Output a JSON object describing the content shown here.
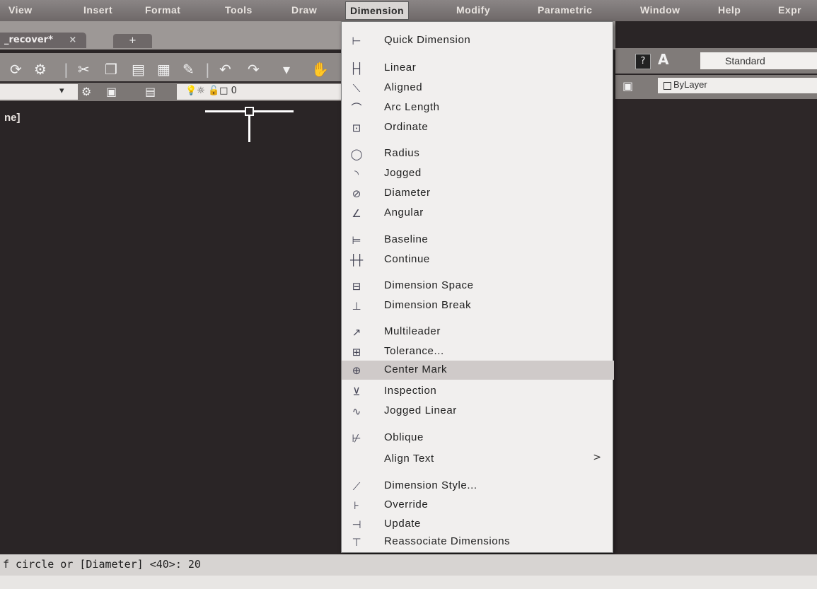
{
  "menubar": {
    "items": [
      "View",
      "Insert",
      "Format",
      "Tools",
      "Draw",
      "Dimension",
      "Modify",
      "Parametric",
      "Window",
      "Help",
      "Expr"
    ],
    "active": "Dimension"
  },
  "file_tabs": {
    "current": "_recover*",
    "close_symbol": "×",
    "new_tab_symbol": "+"
  },
  "toolbar_right": {
    "help_symbol": "?",
    "text_style_icon": "A",
    "text_style_value": "Standard",
    "layer_value": "ByLayer"
  },
  "layer_control": {
    "layer_name": "0"
  },
  "viewport": {
    "label": "ne]"
  },
  "dimension_menu": {
    "items": [
      {
        "label": "Quick Dimension",
        "icon": "quick-dimension-icon"
      },
      {
        "label": "Linear",
        "icon": "linear-icon"
      },
      {
        "label": "Aligned",
        "icon": "aligned-icon"
      },
      {
        "label": "Arc Length",
        "icon": "arc-length-icon"
      },
      {
        "label": "Ordinate",
        "icon": "ordinate-icon"
      },
      {
        "label": "Radius",
        "icon": "radius-icon"
      },
      {
        "label": "Jogged",
        "icon": "jogged-icon"
      },
      {
        "label": "Diameter",
        "icon": "diameter-icon"
      },
      {
        "label": "Angular",
        "icon": "angular-icon"
      },
      {
        "label": "Baseline",
        "icon": "baseline-icon"
      },
      {
        "label": "Continue",
        "icon": "continue-icon"
      },
      {
        "label": "Dimension Space",
        "icon": "dimension-space-icon"
      },
      {
        "label": "Dimension Break",
        "icon": "dimension-break-icon"
      },
      {
        "label": "Multileader",
        "icon": "multileader-icon"
      },
      {
        "label": "Tolerance...",
        "icon": "tolerance-icon"
      },
      {
        "label": "Center Mark",
        "icon": "center-mark-icon"
      },
      {
        "label": "Inspection",
        "icon": "inspection-icon"
      },
      {
        "label": "Jogged Linear",
        "icon": "jogged-linear-icon"
      },
      {
        "label": "Oblique",
        "icon": "oblique-icon"
      },
      {
        "label": "Align Text",
        "icon": "",
        "submenu": ">"
      },
      {
        "label": "Dimension Style...",
        "icon": "dimension-style-icon"
      },
      {
        "label": "Override",
        "icon": "override-icon"
      },
      {
        "label": "Update",
        "icon": "update-icon"
      },
      {
        "label": "Reassociate Dimensions",
        "icon": "reassociate-dimensions-icon"
      }
    ],
    "highlighted": "Center Mark"
  },
  "command_line": {
    "text": "f circle or [Diameter] <40>: 20"
  },
  "colors": {
    "canvas": "#2a2526",
    "menu_bg": "#f1efee",
    "highlight": "#cfcac9"
  }
}
